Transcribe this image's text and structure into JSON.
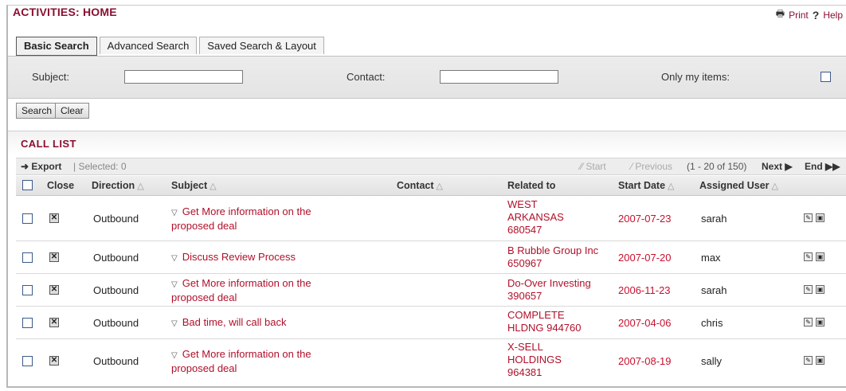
{
  "header": {
    "title": "ACTIVITIES: HOME",
    "print_label": "Print",
    "help_label": "Help"
  },
  "tabs": [
    {
      "label": "Basic Search",
      "active": true
    },
    {
      "label": "Advanced Search",
      "active": false
    },
    {
      "label": "Saved Search & Layout",
      "active": false
    }
  ],
  "search": {
    "subject_label": "Subject:",
    "subject_value": "",
    "contact_label": "Contact:",
    "contact_value": "",
    "only_my_items_label": "Only my items:",
    "only_my_items_checked": false,
    "search_button": "Search",
    "clear_button": "Clear"
  },
  "list": {
    "title": "CALL LIST",
    "export_label": "Export",
    "selected_label": "| Selected: 0",
    "pager": {
      "start": "Start",
      "previous": "Previous",
      "range": "(1 - 20 of 150)",
      "next": "Next",
      "end": "End"
    },
    "columns": {
      "close": "Close",
      "direction": "Direction",
      "subject": "Subject",
      "contact": "Contact",
      "related_to": "Related to",
      "start_date": "Start Date",
      "assigned_user": "Assigned User"
    },
    "rows": [
      {
        "direction": "Outbound",
        "subject": "Get More information on the proposed deal",
        "contact": "",
        "related_to": "WEST ARKANSAS 680547",
        "start_date": "2007-07-23",
        "assigned_user": "sarah"
      },
      {
        "direction": "Outbound",
        "subject": "Discuss Review Process",
        "contact": "",
        "related_to": "B Rubble Group Inc 650967",
        "start_date": "2007-07-20",
        "assigned_user": "max"
      },
      {
        "direction": "Outbound",
        "subject": "Get More information on the proposed deal",
        "contact": "",
        "related_to": "Do-Over Investing 390657",
        "start_date": "2006-11-23",
        "assigned_user": "sarah"
      },
      {
        "direction": "Outbound",
        "subject": "Bad time, will call back",
        "contact": "",
        "related_to": "COMPLETE HLDNG 944760",
        "start_date": "2007-04-06",
        "assigned_user": "chris"
      },
      {
        "direction": "Outbound",
        "subject": "Get More information on the proposed deal",
        "contact": "",
        "related_to": "X-SELL HOLDINGS 964381",
        "start_date": "2007-08-19",
        "assigned_user": "sally"
      }
    ]
  },
  "colors": {
    "brand": "#8a1030",
    "link": "#b0102a",
    "date": "#c8102e"
  }
}
